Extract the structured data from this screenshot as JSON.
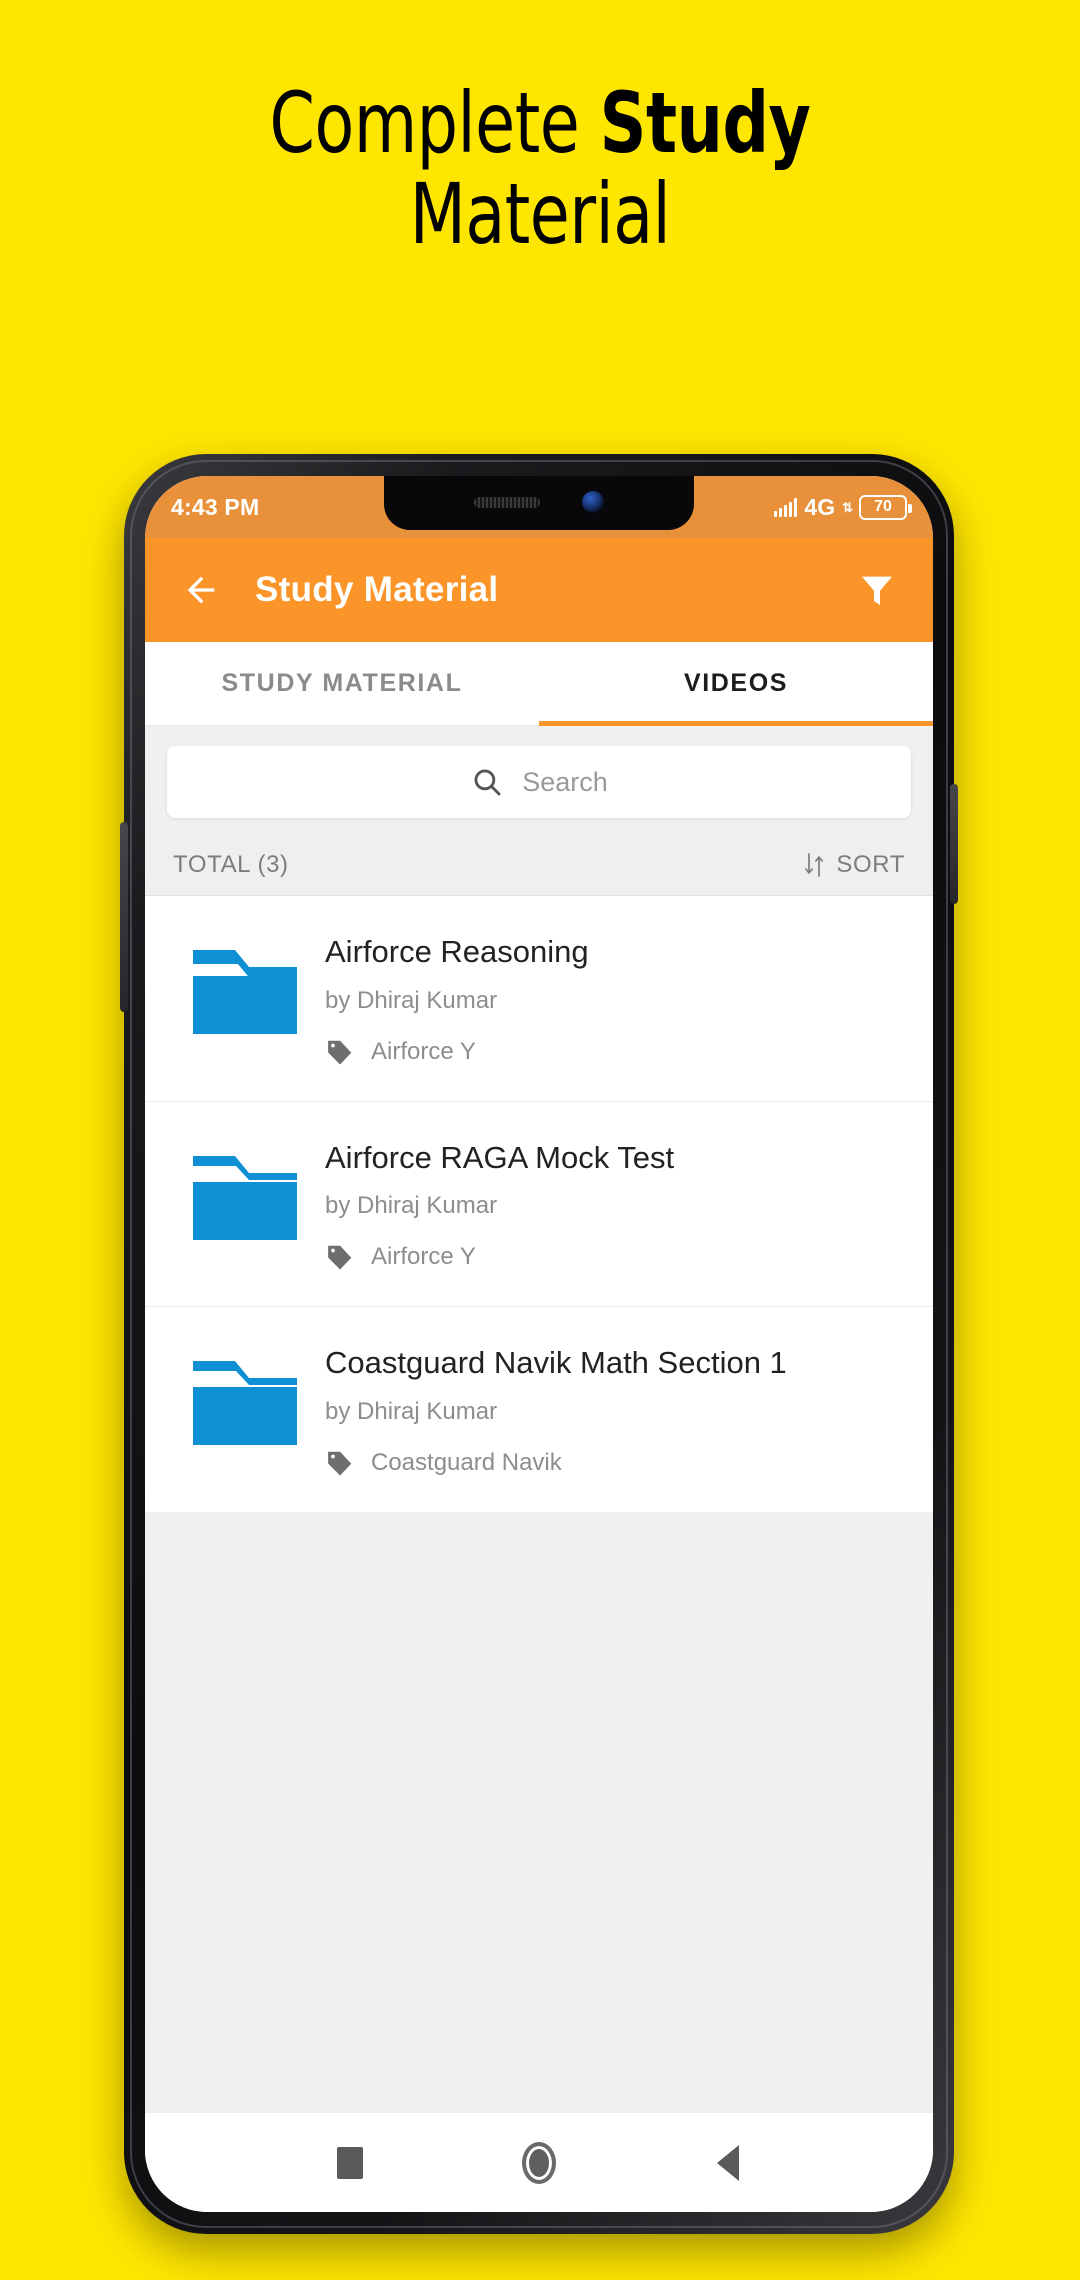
{
  "promo": {
    "line1_normal": "Complete ",
    "line1_strong": "Study",
    "line2": "Material",
    "bg_color": "#FFE600"
  },
  "statusbar": {
    "time": "4:43 PM",
    "network": "4G",
    "data_arrows": "⇅",
    "battery_percent": "70",
    "signal_icon": "signal-bars-icon",
    "speaker_icon": "speaker-grille-icon",
    "camera_icon": "front-camera-icon"
  },
  "appbar": {
    "back_icon": "back-arrow-icon",
    "title": "Study Material",
    "filter_icon": "filter-funnel-icon",
    "color": "#FB9529"
  },
  "tabs": [
    {
      "label": "STUDY MATERIAL",
      "active": false
    },
    {
      "label": "VIDEOS",
      "active": true
    }
  ],
  "search": {
    "placeholder": "Search",
    "value": "",
    "icon": "search-icon"
  },
  "listheader": {
    "total_label": "TOTAL (3)",
    "sort_label": "SORT",
    "sort_icon": "sort-arrows-icon"
  },
  "items": [
    {
      "title": "Airforce Reasoning",
      "author": "by Dhiraj Kumar",
      "tag": "Airforce Y",
      "folder_icon": "folder-icon",
      "tag_icon": "tag-icon"
    },
    {
      "title": "Airforce RAGA Mock Test",
      "author": "by Dhiraj Kumar",
      "tag": "Airforce Y",
      "folder_icon": "folder-icon",
      "tag_icon": "tag-icon"
    },
    {
      "title": "Coastguard Navik Math Section 1",
      "author": "by Dhiraj Kumar",
      "tag": "Coastguard Navik",
      "folder_icon": "folder-icon",
      "tag_icon": "tag-icon"
    }
  ],
  "navbar": {
    "recents_icon": "recents-square-icon",
    "home_icon": "home-circle-icon",
    "back_icon": "back-triangle-icon"
  },
  "colors": {
    "accent_orange": "#FB9529",
    "statusbar_orange": "#E8913A",
    "folder_blue": "#1090D4",
    "page_yellow": "#FFE600"
  }
}
